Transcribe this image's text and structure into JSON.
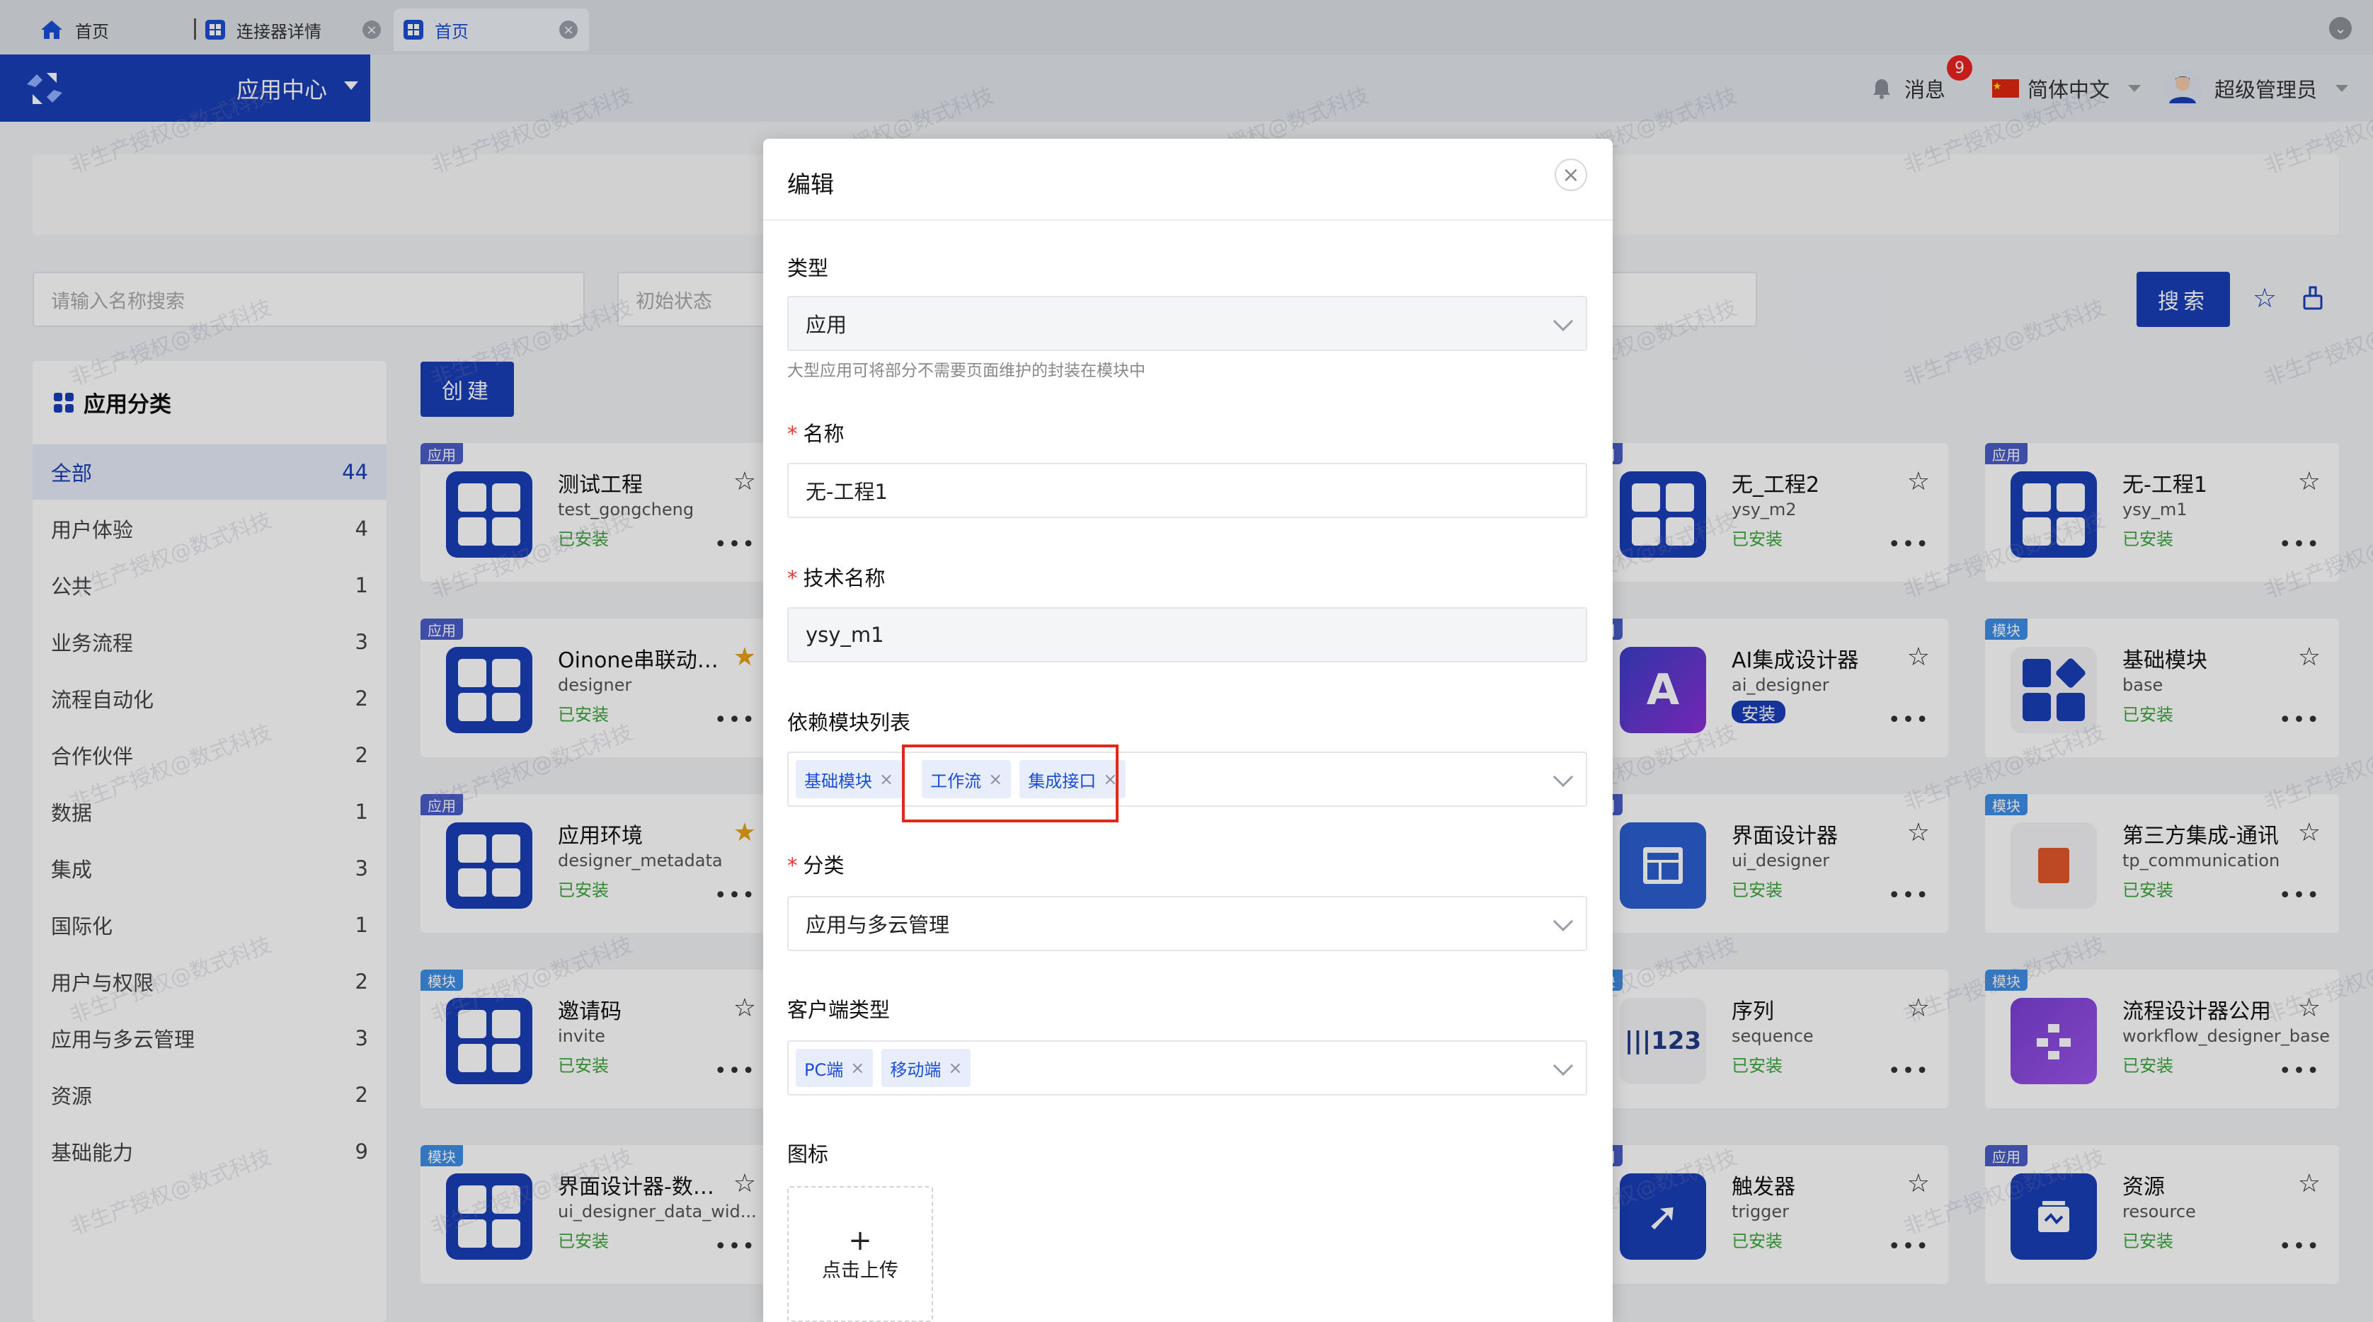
{
  "tabs": [
    {
      "label": "首页",
      "icon": "home-icon"
    },
    {
      "label": "连接器详情",
      "icon": "app-icon"
    },
    {
      "label": "首页",
      "icon": "app-icon"
    }
  ],
  "header": {
    "app_center": "应用中心",
    "messages": "消息",
    "message_count": "9",
    "language": "简体中文",
    "user": "超级管理员"
  },
  "filters": {
    "name_placeholder": "请输入名称搜索",
    "status_placeholder": "初始状态",
    "search_label": "搜索"
  },
  "sidebar": {
    "title": "应用分类",
    "items": [
      {
        "label": "全部",
        "count": "44"
      },
      {
        "label": "用户体验",
        "count": "4"
      },
      {
        "label": "公共",
        "count": "1"
      },
      {
        "label": "业务流程",
        "count": "3"
      },
      {
        "label": "流程自动化",
        "count": "2"
      },
      {
        "label": "合作伙伴",
        "count": "2"
      },
      {
        "label": "数据",
        "count": "1"
      },
      {
        "label": "集成",
        "count": "3"
      },
      {
        "label": "国际化",
        "count": "1"
      },
      {
        "label": "用户与权限",
        "count": "2"
      },
      {
        "label": "应用与多云管理",
        "count": "3"
      },
      {
        "label": "资源",
        "count": "2"
      },
      {
        "label": "基础能力",
        "count": "9"
      }
    ]
  },
  "create_label": "创建",
  "cards": [
    {
      "tag": "应用",
      "name": "测试工程",
      "tech": "test_gongcheng",
      "status": "已安装"
    },
    {
      "tag": "应用",
      "name": "Oinone串联动作...",
      "tech": "designer",
      "status": "已安装"
    },
    {
      "tag": "应用",
      "name": "应用环境",
      "tech": "designer_metadata",
      "status": "已安装"
    },
    {
      "tag": "模块",
      "name": "邀请码",
      "tech": "invite",
      "status": "已安装"
    },
    {
      "tag": "模块",
      "name": "界面设计器-数据分...",
      "tech": "ui_designer_data_wid...",
      "status": "已安装"
    },
    {
      "tag": "用",
      "name": "无_工程2",
      "tech": "ysy_m2",
      "status": "已安装"
    },
    {
      "tag": "用",
      "name": "AI集成设计器",
      "tech": "ai_designer",
      "status": "安装"
    },
    {
      "tag": "用",
      "name": "界面设计器",
      "tech": "ui_designer",
      "status": "已安装"
    },
    {
      "tag": "块",
      "name": "序列",
      "tech": "sequence",
      "status": "已安装"
    },
    {
      "tag": "用",
      "name": "触发器",
      "tech": "trigger",
      "status": "已安装"
    },
    {
      "tag": "应用",
      "name": "无-工程1",
      "tech": "ysy_m1",
      "status": "已安装"
    },
    {
      "tag": "模块",
      "name": "基础模块",
      "tech": "base",
      "status": "已安装"
    },
    {
      "tag": "模块",
      "name": "第三方集成-通讯",
      "tech": "tp_communication",
      "status": "已安装"
    },
    {
      "tag": "模块",
      "name": "流程设计器公用",
      "tech": "workflow_designer_base",
      "status": "已安装"
    },
    {
      "tag": "应用",
      "name": "资源",
      "tech": "resource",
      "status": "已安装"
    }
  ],
  "watermark": "非生产授权@数式科技",
  "modal": {
    "title": "编辑",
    "type_label": "类型",
    "type_value": "应用",
    "type_hint": "大型应用可将部分不需要页面维护的封装在模块中",
    "name_label": "名称",
    "name_value": "无-工程1",
    "tech_label": "技术名称",
    "tech_value": "ysy_m1",
    "deps_label": "依赖模块列表",
    "deps": [
      "基础模块",
      "工作流",
      "集成接口"
    ],
    "category_label": "分类",
    "category_value": "应用与多云管理",
    "client_label": "客户端类型",
    "clients": [
      "PC端",
      "移动端"
    ],
    "icon_label": "图标",
    "upload_label": "点击上传",
    "upload_plus": "+"
  },
  "colors": {
    "brand": "#1a3fb8",
    "highlight": "#e0291c",
    "installed": "#3ca53c"
  }
}
